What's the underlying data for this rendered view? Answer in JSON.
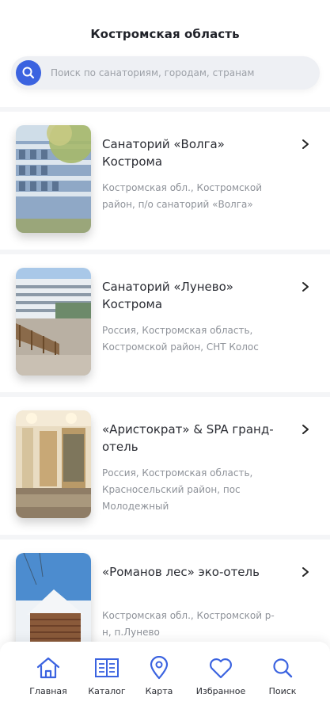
{
  "header": {
    "title": "Костромская область"
  },
  "search": {
    "placeholder": "Поиск по санаториям, городам, странам"
  },
  "cards": [
    {
      "name": "Санаторий «Волга» Кострома",
      "address": "Костромская обл., Костромской район, п/о санаторий «Волга»"
    },
    {
      "name": "Санаторий «Лунево» Кострома",
      "address": "Россия, Костромская область, Костромской район, СНТ Колос"
    },
    {
      "name": "«Аристократ» & SPA гранд-отель",
      "address": "Россия, Костромская область, Красносельский район, пос Молодежный"
    },
    {
      "name": "«Романов лес» эко-отель",
      "address": "Костромская обл., Костромской р-н, п.Лунево"
    }
  ],
  "tabbar": {
    "items": [
      {
        "label": "Главная",
        "icon": "home-icon"
      },
      {
        "label": "Каталог",
        "icon": "catalog-icon"
      },
      {
        "label": "Карта",
        "icon": "map-pin-icon"
      },
      {
        "label": "Избранное",
        "icon": "heart-icon"
      },
      {
        "label": "Поиск",
        "icon": "search-icon"
      }
    ]
  },
  "colors": {
    "accent": "#3b63e0",
    "text": "#2a2c33",
    "muted": "#8e9299"
  }
}
